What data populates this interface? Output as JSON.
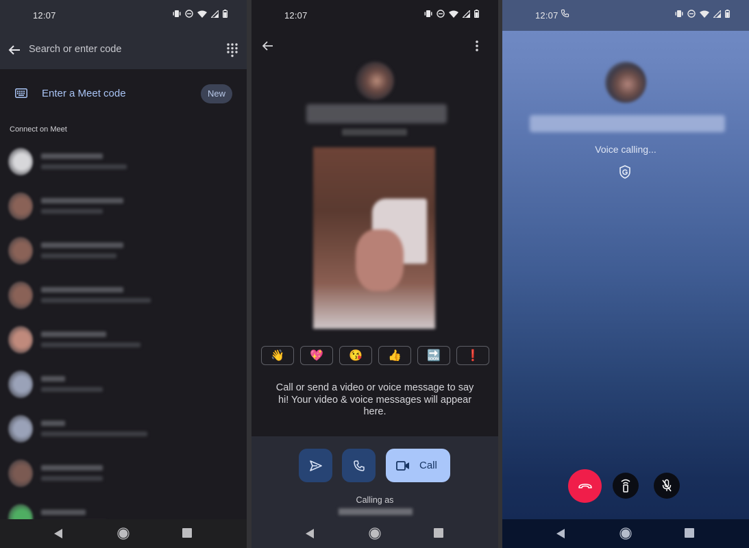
{
  "status_bar": {
    "time": "12:07",
    "icons": [
      "vibrate-icon",
      "do-not-disturb-icon",
      "wifi-icon",
      "signal-icon",
      "battery-icon"
    ]
  },
  "contacts_screen": {
    "search_placeholder": "Search or enter code",
    "meet_code_label": "Enter a Meet code",
    "new_badge": "New",
    "section_label": "Connect on Meet",
    "contacts": [
      {
        "name": "[blurred]",
        "detail": "[blurred]",
        "avatar_color": "#d7d7da"
      },
      {
        "name": "[blurred]",
        "detail": "[blurred]",
        "avatar_color": "#8a6257"
      },
      {
        "name": "[blurred]",
        "detail": "[blurred]",
        "avatar_color": "#8a6257"
      },
      {
        "name": "[blurred]",
        "detail": "[blurred]",
        "avatar_color": "#8a6257"
      },
      {
        "name": "[blurred]",
        "detail": "[blurred]",
        "avatar_color": "#c08a7c"
      },
      {
        "name": "[blurred]",
        "detail": "[blurred]",
        "avatar_color": "#9aa2b8"
      },
      {
        "name": "[blurred]",
        "detail": "[blurred]",
        "avatar_color": "#9aa2b8"
      },
      {
        "name": "[blurred]",
        "detail": "[blurred]",
        "avatar_color": "#7b5a52"
      },
      {
        "name": "[blurred]",
        "detail": "[blurred]",
        "avatar_color": "#4fae62"
      }
    ]
  },
  "conversation_screen": {
    "contact_name": "[blurred]",
    "reactions": [
      "👋",
      "💖",
      "😘",
      "👍",
      "🔜",
      "❗"
    ],
    "empty_message": "Call or send a video or voice message to say hi! Your video & voice messages will appear here.",
    "call_button_label": "Call",
    "calling_as_label": "Calling as",
    "calling_as_number": "[blurred]"
  },
  "calling_screen": {
    "contact_name": "[blurred]",
    "status": "Voice calling..."
  },
  "colors": {
    "accent_light_blue": "#a9c6fa",
    "button_dark_blue": "#274474",
    "end_call_red": "#f01e4a",
    "link_blue": "#a9c4f5"
  }
}
